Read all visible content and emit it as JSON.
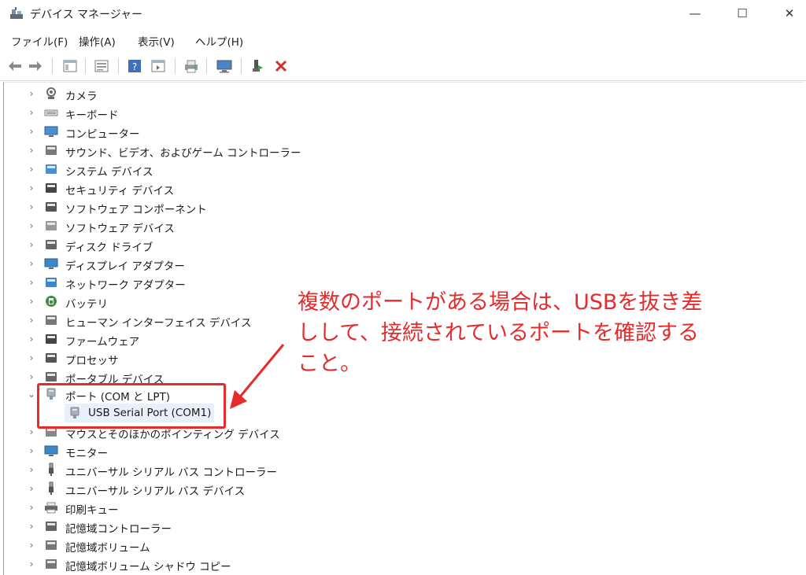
{
  "window": {
    "title": "デバイス マネージャー",
    "controls": {
      "minimize": "—",
      "maximize": "☐",
      "close": "✕"
    }
  },
  "menu": [
    "ファイル(F)",
    "操作(A)",
    "表示(V)",
    "ヘルプ(H)"
  ],
  "toolbar": {
    "buttons": [
      "back-icon",
      "forward-icon",
      "properties-view-icon",
      "list-view-icon",
      "help-icon",
      "details-icon",
      "print-icon",
      "scan-hardware-icon",
      "enable-device-icon",
      "uninstall-device-icon"
    ]
  },
  "tree": {
    "items": [
      {
        "label": "カメラ",
        "icon": "camera-icon"
      },
      {
        "label": "キーボード",
        "icon": "keyboard-icon"
      },
      {
        "label": "コンピューター",
        "icon": "computer-icon"
      },
      {
        "label": "サウンド、ビデオ、およびゲーム コントローラー",
        "icon": "speaker-icon"
      },
      {
        "label": "システム デバイス",
        "icon": "system-folder-icon"
      },
      {
        "label": "セキュリティ デバイス",
        "icon": "security-key-icon"
      },
      {
        "label": "ソフトウェア コンポーネント",
        "icon": "software-component-icon"
      },
      {
        "label": "ソフトウェア デバイス",
        "icon": "software-device-icon"
      },
      {
        "label": "ディスク ドライブ",
        "icon": "disk-drive-icon"
      },
      {
        "label": "ディスプレイ アダプター",
        "icon": "display-adapter-icon"
      },
      {
        "label": "ネットワーク アダプター",
        "icon": "network-adapter-icon"
      },
      {
        "label": "バッテリ",
        "icon": "battery-icon"
      },
      {
        "label": "ヒューマン インターフェイス デバイス",
        "icon": "hid-icon"
      },
      {
        "label": "ファームウェア",
        "icon": "firmware-icon"
      },
      {
        "label": "プロセッサ",
        "icon": "processor-icon"
      },
      {
        "label": "ポータブル デバイス",
        "icon": "portable-device-icon"
      },
      {
        "label": "ポート (COM と LPT)",
        "icon": "port-icon",
        "expanded": true,
        "children": [
          {
            "label": "USB Serial Port (COM1)",
            "icon": "serial-port-icon"
          }
        ]
      },
      {
        "label": "マウスとそのほかのポインティング デバイス",
        "icon": "mouse-icon"
      },
      {
        "label": "モニター",
        "icon": "monitor-icon"
      },
      {
        "label": "ユニバーサル シリアル バス コントローラー",
        "icon": "usb-icon"
      },
      {
        "label": "ユニバーサル シリアル バス デバイス",
        "icon": "usb-device-icon"
      },
      {
        "label": "印刷キュー",
        "icon": "printer-icon"
      },
      {
        "label": "記憶域コントローラー",
        "icon": "storage-controller-icon"
      },
      {
        "label": "記憶域ボリューム",
        "icon": "storage-volume-icon"
      },
      {
        "label": "記憶域ボリューム シャドウ コピー",
        "icon": "shadow-copy-icon"
      }
    ]
  },
  "annotation": {
    "lines": [
      "複数のポートがある場合は、USBを抜き差",
      "しして、接続されているポートを確認する",
      "こと。"
    ],
    "color": "#e52b2b"
  }
}
